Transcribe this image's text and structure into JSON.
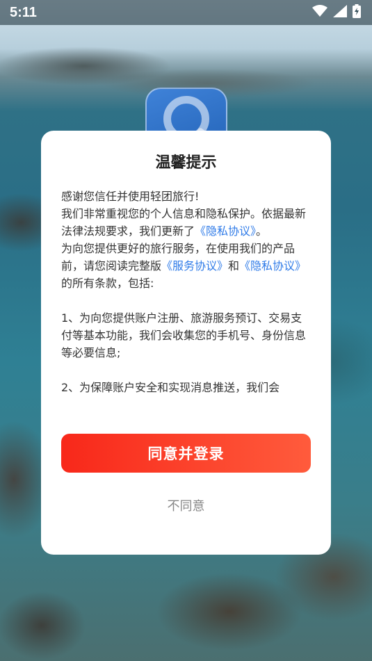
{
  "status_bar": {
    "time": "5:11",
    "icons": [
      "wifi-icon",
      "cellular-signal-icon",
      "battery-charging-icon"
    ]
  },
  "app_logo": {
    "icon": "q-logo-icon"
  },
  "dialog": {
    "title": "温馨提示",
    "body": {
      "line1": "感谢您信任并使用轻团旅行!",
      "p2_text1": "我们非常重视您的个人信息和隐私保护。依据最新法律法规要求，我们更新了",
      "p2_link": "《隐私协议》",
      "p2_text2": "。",
      "p3_text1": "为向您提供更好的旅行服务，在使用我们的产品前，请您阅读完整版",
      "p3_link1": "《服务协议》",
      "p3_text2": "和",
      "p3_link2": "《隐私协议》",
      "p3_text3": "的所有条款，包括:",
      "item1": "1、为向您提供账户注册、旅游服务预订、交易支付等基本功能，我们会收集您的手机号、身份信息等必要信息;",
      "item2": "2、为保障账户安全和实现消息推送，我们会"
    },
    "agree_label": "同意并登录",
    "disagree_label": "不同意"
  },
  "colors": {
    "accent_start": "#f8281a",
    "accent_end": "#ff5b3c",
    "link": "#2f7be8"
  }
}
